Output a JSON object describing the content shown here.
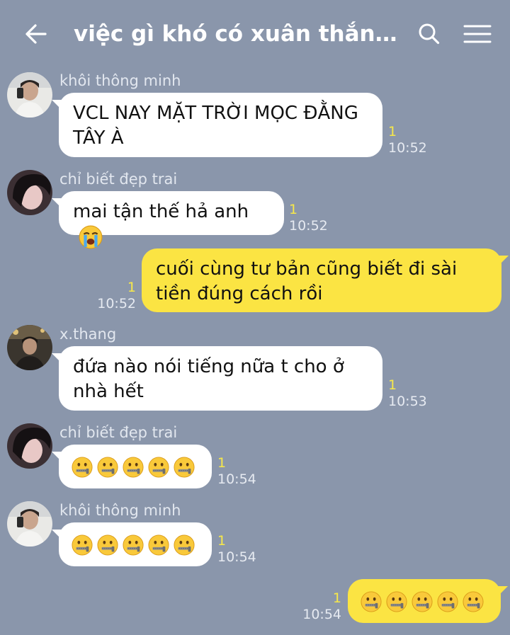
{
  "header": {
    "title": "việc gì khó có xuân thắng l...",
    "back_icon": "arrow-left-icon",
    "search_icon": "search-icon",
    "menu_icon": "menu-icon"
  },
  "colors": {
    "background": "#8a96ab",
    "incoming_bubble": "#ffffff",
    "outgoing_bubble": "#fbe443",
    "unread": "#f7e84a"
  },
  "messages": [
    {
      "sender": "khôi thông minh",
      "text": "VCL NAY MẶT TRỜI MỌC ĐẰNG TÂY À",
      "unread": "1",
      "time": "10:52"
    },
    {
      "sender": "chỉ biết đẹp trai",
      "text": "mai tận thế hả anh",
      "emoji": "loudly-crying-face",
      "unread": "1",
      "time": "10:52"
    },
    {
      "text": "cuối cùng tư bản cũng biết đi sài tiền đúng cách rồi",
      "unread": "1",
      "time": "10:52"
    },
    {
      "sender": "x.thang",
      "text": "đứa nào nói tiếng nữa t cho ở nhà hết",
      "unread": "1",
      "time": "10:53"
    },
    {
      "sender": "chỉ biết đẹp trai",
      "emoji": "zipper-mouth-face",
      "emoji_count": 5,
      "unread": "1",
      "time": "10:54"
    },
    {
      "sender": "khôi thông minh",
      "emoji": "zipper-mouth-face",
      "emoji_count": 5,
      "unread": "1",
      "time": "10:54"
    },
    {
      "emoji": "zipper-mouth-face",
      "emoji_count": 5,
      "unread": "1",
      "time": "10:54"
    }
  ]
}
